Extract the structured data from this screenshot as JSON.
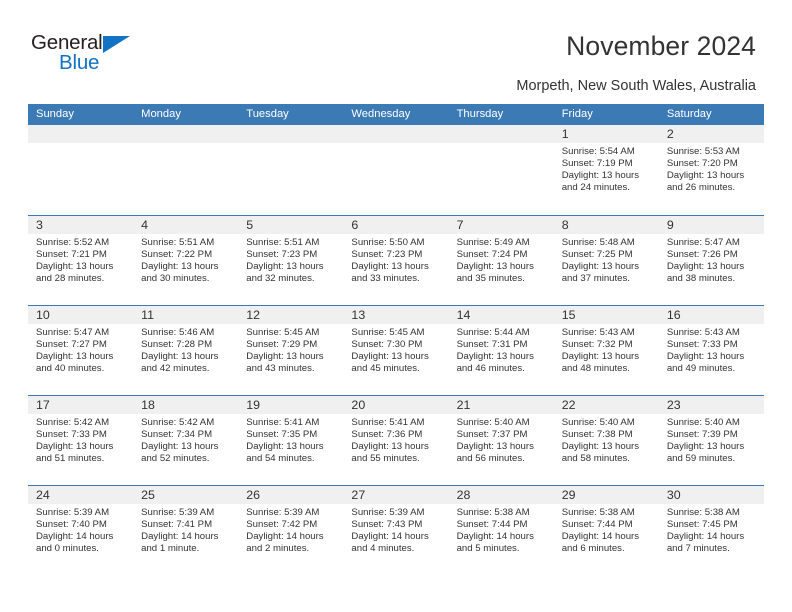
{
  "brand": {
    "name_part1": "General",
    "name_part2": "Blue",
    "accent_color": "#1273c4",
    "triangle_icon": "triangle-logo-icon"
  },
  "header": {
    "title": "November 2024",
    "subtitle": "Morpeth, New South Wales, Australia"
  },
  "theme": {
    "header_blue": "#3c7ab5",
    "daynum_band": "#f0f0f0",
    "text": "#333333"
  },
  "calendar": {
    "weekday_headers": [
      "Sunday",
      "Monday",
      "Tuesday",
      "Wednesday",
      "Thursday",
      "Friday",
      "Saturday"
    ],
    "weeks": [
      [
        {
          "day": "",
          "empty": true
        },
        {
          "day": "",
          "empty": true
        },
        {
          "day": "",
          "empty": true
        },
        {
          "day": "",
          "empty": true
        },
        {
          "day": "",
          "empty": true
        },
        {
          "day": "1",
          "sunrise": "Sunrise: 5:54 AM",
          "sunset": "Sunset: 7:19 PM",
          "daylight1": "Daylight: 13 hours",
          "daylight2": "and 24 minutes."
        },
        {
          "day": "2",
          "sunrise": "Sunrise: 5:53 AM",
          "sunset": "Sunset: 7:20 PM",
          "daylight1": "Daylight: 13 hours",
          "daylight2": "and 26 minutes."
        }
      ],
      [
        {
          "day": "3",
          "sunrise": "Sunrise: 5:52 AM",
          "sunset": "Sunset: 7:21 PM",
          "daylight1": "Daylight: 13 hours",
          "daylight2": "and 28 minutes."
        },
        {
          "day": "4",
          "sunrise": "Sunrise: 5:51 AM",
          "sunset": "Sunset: 7:22 PM",
          "daylight1": "Daylight: 13 hours",
          "daylight2": "and 30 minutes."
        },
        {
          "day": "5",
          "sunrise": "Sunrise: 5:51 AM",
          "sunset": "Sunset: 7:23 PM",
          "daylight1": "Daylight: 13 hours",
          "daylight2": "and 32 minutes."
        },
        {
          "day": "6",
          "sunrise": "Sunrise: 5:50 AM",
          "sunset": "Sunset: 7:23 PM",
          "daylight1": "Daylight: 13 hours",
          "daylight2": "and 33 minutes."
        },
        {
          "day": "7",
          "sunrise": "Sunrise: 5:49 AM",
          "sunset": "Sunset: 7:24 PM",
          "daylight1": "Daylight: 13 hours",
          "daylight2": "and 35 minutes."
        },
        {
          "day": "8",
          "sunrise": "Sunrise: 5:48 AM",
          "sunset": "Sunset: 7:25 PM",
          "daylight1": "Daylight: 13 hours",
          "daylight2": "and 37 minutes."
        },
        {
          "day": "9",
          "sunrise": "Sunrise: 5:47 AM",
          "sunset": "Sunset: 7:26 PM",
          "daylight1": "Daylight: 13 hours",
          "daylight2": "and 38 minutes."
        }
      ],
      [
        {
          "day": "10",
          "sunrise": "Sunrise: 5:47 AM",
          "sunset": "Sunset: 7:27 PM",
          "daylight1": "Daylight: 13 hours",
          "daylight2": "and 40 minutes."
        },
        {
          "day": "11",
          "sunrise": "Sunrise: 5:46 AM",
          "sunset": "Sunset: 7:28 PM",
          "daylight1": "Daylight: 13 hours",
          "daylight2": "and 42 minutes."
        },
        {
          "day": "12",
          "sunrise": "Sunrise: 5:45 AM",
          "sunset": "Sunset: 7:29 PM",
          "daylight1": "Daylight: 13 hours",
          "daylight2": "and 43 minutes."
        },
        {
          "day": "13",
          "sunrise": "Sunrise: 5:45 AM",
          "sunset": "Sunset: 7:30 PM",
          "daylight1": "Daylight: 13 hours",
          "daylight2": "and 45 minutes."
        },
        {
          "day": "14",
          "sunrise": "Sunrise: 5:44 AM",
          "sunset": "Sunset: 7:31 PM",
          "daylight1": "Daylight: 13 hours",
          "daylight2": "and 46 minutes."
        },
        {
          "day": "15",
          "sunrise": "Sunrise: 5:43 AM",
          "sunset": "Sunset: 7:32 PM",
          "daylight1": "Daylight: 13 hours",
          "daylight2": "and 48 minutes."
        },
        {
          "day": "16",
          "sunrise": "Sunrise: 5:43 AM",
          "sunset": "Sunset: 7:33 PM",
          "daylight1": "Daylight: 13 hours",
          "daylight2": "and 49 minutes."
        }
      ],
      [
        {
          "day": "17",
          "sunrise": "Sunrise: 5:42 AM",
          "sunset": "Sunset: 7:33 PM",
          "daylight1": "Daylight: 13 hours",
          "daylight2": "and 51 minutes."
        },
        {
          "day": "18",
          "sunrise": "Sunrise: 5:42 AM",
          "sunset": "Sunset: 7:34 PM",
          "daylight1": "Daylight: 13 hours",
          "daylight2": "and 52 minutes."
        },
        {
          "day": "19",
          "sunrise": "Sunrise: 5:41 AM",
          "sunset": "Sunset: 7:35 PM",
          "daylight1": "Daylight: 13 hours",
          "daylight2": "and 54 minutes."
        },
        {
          "day": "20",
          "sunrise": "Sunrise: 5:41 AM",
          "sunset": "Sunset: 7:36 PM",
          "daylight1": "Daylight: 13 hours",
          "daylight2": "and 55 minutes."
        },
        {
          "day": "21",
          "sunrise": "Sunrise: 5:40 AM",
          "sunset": "Sunset: 7:37 PM",
          "daylight1": "Daylight: 13 hours",
          "daylight2": "and 56 minutes."
        },
        {
          "day": "22",
          "sunrise": "Sunrise: 5:40 AM",
          "sunset": "Sunset: 7:38 PM",
          "daylight1": "Daylight: 13 hours",
          "daylight2": "and 58 minutes."
        },
        {
          "day": "23",
          "sunrise": "Sunrise: 5:40 AM",
          "sunset": "Sunset: 7:39 PM",
          "daylight1": "Daylight: 13 hours",
          "daylight2": "and 59 minutes."
        }
      ],
      [
        {
          "day": "24",
          "sunrise": "Sunrise: 5:39 AM",
          "sunset": "Sunset: 7:40 PM",
          "daylight1": "Daylight: 14 hours",
          "daylight2": "and 0 minutes."
        },
        {
          "day": "25",
          "sunrise": "Sunrise: 5:39 AM",
          "sunset": "Sunset: 7:41 PM",
          "daylight1": "Daylight: 14 hours",
          "daylight2": "and 1 minute."
        },
        {
          "day": "26",
          "sunrise": "Sunrise: 5:39 AM",
          "sunset": "Sunset: 7:42 PM",
          "daylight1": "Daylight: 14 hours",
          "daylight2": "and 2 minutes."
        },
        {
          "day": "27",
          "sunrise": "Sunrise: 5:39 AM",
          "sunset": "Sunset: 7:43 PM",
          "daylight1": "Daylight: 14 hours",
          "daylight2": "and 4 minutes."
        },
        {
          "day": "28",
          "sunrise": "Sunrise: 5:38 AM",
          "sunset": "Sunset: 7:44 PM",
          "daylight1": "Daylight: 14 hours",
          "daylight2": "and 5 minutes."
        },
        {
          "day": "29",
          "sunrise": "Sunrise: 5:38 AM",
          "sunset": "Sunset: 7:44 PM",
          "daylight1": "Daylight: 14 hours",
          "daylight2": "and 6 minutes."
        },
        {
          "day": "30",
          "sunrise": "Sunrise: 5:38 AM",
          "sunset": "Sunset: 7:45 PM",
          "daylight1": "Daylight: 14 hours",
          "daylight2": "and 7 minutes."
        }
      ]
    ]
  }
}
